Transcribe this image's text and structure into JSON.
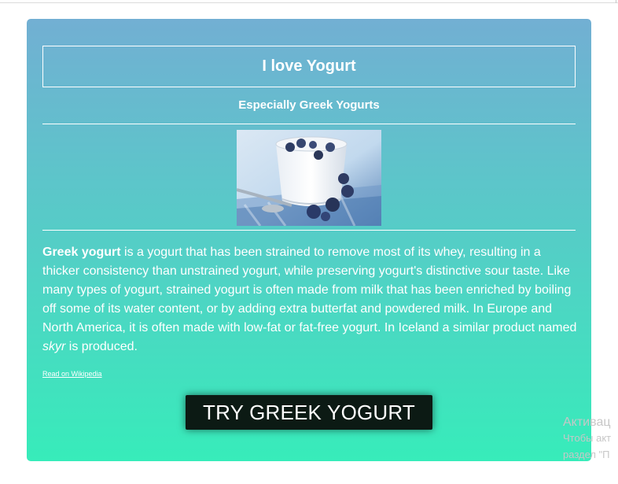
{
  "card": {
    "title": "I love Yogurt",
    "subtitle": "Especially Greek Yogurts",
    "image": {
      "icon": "yogurt-bowl-with-blueberries-photo"
    },
    "description": {
      "bold_lead": "Greek yogurt",
      "part1": " is a yogurt that has been strained to remove most of its whey, resulting in a thicker consistency than unstrained yogurt, while preserving yogurt's distinctive sour taste. Like many types of yogurt, strained yogurt is often made from milk that has been enriched by boiling off some of its water content, or by adding extra butterfat and powdered milk. In Europe and North America, it is often made with low-fat or fat-free yogurt. In Iceland a similar product named ",
      "italic_word": "skyr",
      "part2": " is produced."
    },
    "link_label": "Read on Wikipedia",
    "cta_label": "TRY GREEK YOGURT"
  },
  "watermark": {
    "line1": "Активац",
    "line2": "Чтобы акт",
    "line3": "раздел \"П"
  },
  "colors": {
    "gradient_top": "#72afd3",
    "gradient_bottom": "#37ecba",
    "button_bg": "#0c1a14",
    "text": "#ffffff"
  }
}
